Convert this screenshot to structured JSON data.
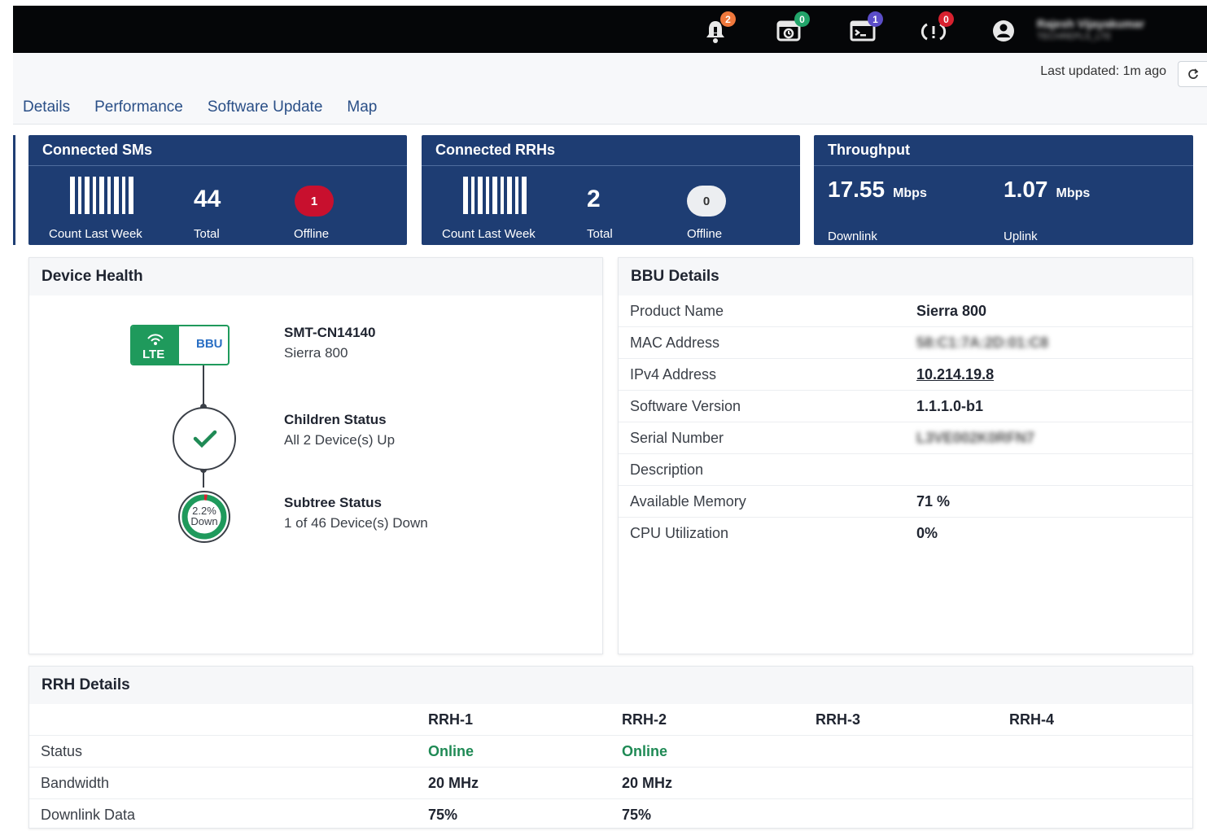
{
  "topbar": {
    "alarms_count": "2",
    "tasks_count": "0",
    "jobs_count": "1",
    "events_count": "0",
    "user_name": "Rajesh Vijayakumar",
    "user_org": "TECHREPLS_LTE",
    "colors": {
      "alarms": "#f0783c",
      "tasks": "#22a46a",
      "jobs": "#5b4dc8",
      "events": "#d8212f"
    }
  },
  "subheader": {
    "last_updated": "Last updated: 1m ago",
    "tabs": [
      "Details",
      "Performance",
      "Software Update",
      "Map"
    ]
  },
  "cards": {
    "sms": {
      "title": "Connected SMs",
      "total": "44",
      "total_label": "Total",
      "offline": "1",
      "offline_label": "Offline",
      "count_label": "Count Last Week"
    },
    "rrhs": {
      "title": "Connected RRHs",
      "total": "2",
      "total_label": "Total",
      "offline": "0",
      "offline_label": "Offline",
      "count_label": "Count Last Week"
    },
    "throughput": {
      "title": "Throughput",
      "downlink": "17.55",
      "uplink": "1.07",
      "unit": "Mbps",
      "downlink_label": "Downlink",
      "uplink_label": "Uplink"
    }
  },
  "device_health": {
    "title": "Device Health",
    "lte_label": "LTE",
    "bbu_label": "BBU",
    "device_name": "SMT-CN14140",
    "device_model": "Sierra 800",
    "children_title": "Children Status",
    "children_status": "All 2 Device(s) Up",
    "subtree_title": "Subtree Status",
    "subtree_status": "1 of 46 Device(s) Down",
    "down_percent": "2.2%",
    "down_label": "Down",
    "down_fraction": 0.022
  },
  "bbu_details": {
    "title": "BBU Details",
    "rows": [
      {
        "key": "Product Name",
        "value": "Sierra 800"
      },
      {
        "key": "MAC Address",
        "value": "58:C1:7A:2D:01:C8"
      },
      {
        "key": "IPv4 Address",
        "value": "10.214.19.8"
      },
      {
        "key": "Software Version",
        "value": "1.1.1.0-b1"
      },
      {
        "key": "Serial Number",
        "value": "L3VE002K0RFN7"
      },
      {
        "key": "Description",
        "value": ""
      },
      {
        "key": "Available Memory",
        "value": "71 %"
      },
      {
        "key": "CPU Utilization",
        "value": "0%"
      }
    ]
  },
  "rrh_details": {
    "title": "RRH Details",
    "columns": [
      "RRH-1",
      "RRH-2",
      "RRH-3",
      "RRH-4"
    ],
    "rows": [
      {
        "key": "Status",
        "values": [
          "Online",
          "Online",
          "",
          ""
        ]
      },
      {
        "key": "Bandwidth",
        "values": [
          "20 MHz",
          "20 MHz",
          "",
          ""
        ]
      },
      {
        "key": "Downlink Data",
        "values": [
          "75%",
          "75%",
          "",
          ""
        ]
      }
    ]
  }
}
